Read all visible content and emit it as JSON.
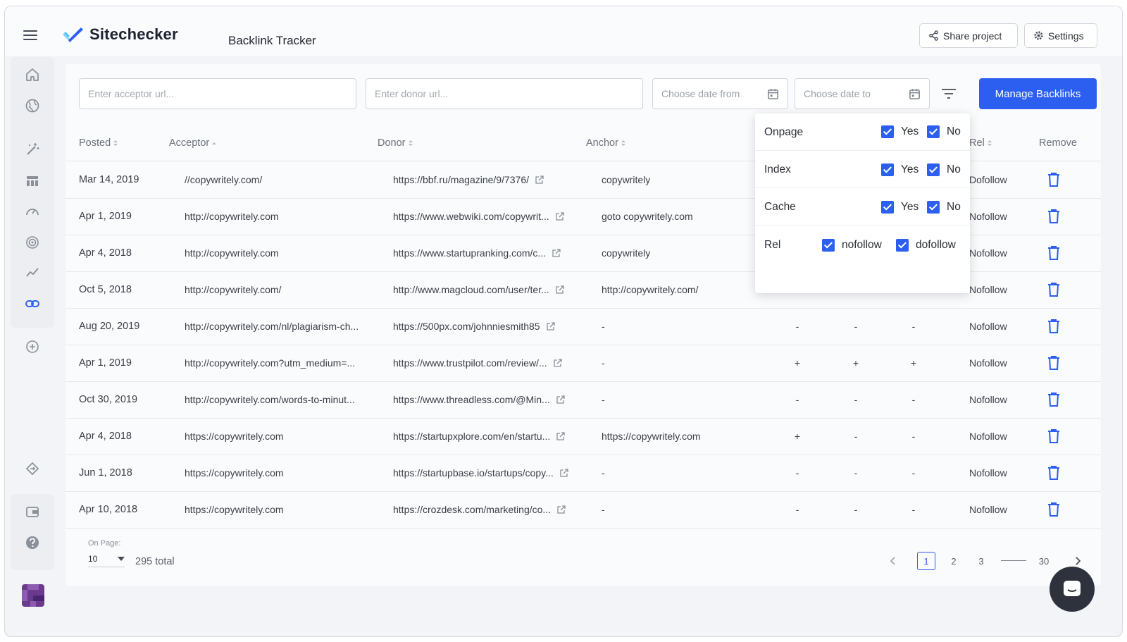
{
  "header": {
    "brand": "Sitechecker",
    "page_title": "Backlink Tracker",
    "share_label": "Share project",
    "settings_label": "Settings"
  },
  "filters": {
    "acceptor_placeholder": "Enter acceptor url...",
    "donor_placeholder": "Enter donor url...",
    "date_from_placeholder": "Choose date from",
    "date_to_placeholder": "Choose date to",
    "manage_label": "Manage Backlinks"
  },
  "columns": {
    "posted": "Posted",
    "acceptor": "Acceptor",
    "donor": "Donor",
    "anchor": "Anchor",
    "rel": "Rel",
    "remove": "Remove"
  },
  "rows": [
    {
      "posted": "Mar 14, 2019",
      "acceptor": "//copywritely.com/",
      "donor": "https://bbf.ru/magazine/9/7376/",
      "anchor": "copywritely",
      "m1": "",
      "m2": "",
      "m3": "",
      "rel": "Dofollow"
    },
    {
      "posted": "Apr 1, 2019",
      "acceptor": "http://copywritely.com",
      "donor": "https://www.webwiki.com/copywrit...",
      "anchor": "goto copywritely.com",
      "m1": "",
      "m2": "",
      "m3": "",
      "rel": "Nofollow"
    },
    {
      "posted": "Apr 4, 2018",
      "acceptor": "http://copywritely.com",
      "donor": "https://www.startupranking.com/c...",
      "anchor": "copywritely",
      "m1": "",
      "m2": "",
      "m3": "",
      "rel": "Nofollow"
    },
    {
      "posted": "Oct 5, 2018",
      "acceptor": "http://copywritely.com/",
      "donor": "http://www.magcloud.com/user/ter...",
      "anchor": "http://copywritely.com/",
      "m1": "",
      "m2": "",
      "m3": "",
      "rel": "Nofollow"
    },
    {
      "posted": "Aug 20, 2019",
      "acceptor": "http://copywritely.com/nl/plagiarism-ch...",
      "donor": "https://500px.com/johnniesmith85",
      "anchor": "-",
      "m1": "-",
      "m2": "-",
      "m3": "-",
      "rel": "Nofollow"
    },
    {
      "posted": "Apr 1, 2019",
      "acceptor": "http://copywritely.com?utm_medium=...",
      "donor": "https://www.trustpilot.com/review/...",
      "anchor": "-",
      "m1": "+",
      "m2": "+",
      "m3": "+",
      "rel": "Nofollow"
    },
    {
      "posted": "Oct 30, 2019",
      "acceptor": "http://copywritely.com/words-to-minut...",
      "donor": "https://www.threadless.com/@Min...",
      "anchor": "-",
      "m1": "-",
      "m2": "-",
      "m3": "-",
      "rel": "Nofollow"
    },
    {
      "posted": "Apr 4, 2018",
      "acceptor": "https://copywritely.com",
      "donor": "https://startupxplore.com/en/startu...",
      "anchor": "https://copywritely.com",
      "m1": "+",
      "m2": "-",
      "m3": "-",
      "rel": "Nofollow"
    },
    {
      "posted": "Jun 1, 2018",
      "acceptor": "https://copywritely.com",
      "donor": "https://startupbase.io/startups/copy...",
      "anchor": "-",
      "m1": "-",
      "m2": "-",
      "m3": "-",
      "rel": "Nofollow"
    },
    {
      "posted": "Apr 10, 2018",
      "acceptor": "https://copywritely.com",
      "donor": "https://crozdesk.com/marketing/co...",
      "anchor": "-",
      "m1": "-",
      "m2": "-",
      "m3": "-",
      "rel": "Nofollow"
    }
  ],
  "footer": {
    "on_page_label": "On Page:",
    "on_page_value": "10",
    "total": "295 total",
    "pages": [
      "1",
      "2",
      "3",
      "30"
    ]
  },
  "filter_popover": {
    "onpage_label": "Onpage",
    "index_label": "Index",
    "cache_label": "Cache",
    "rel_label": "Rel",
    "yes": "Yes",
    "no": "No",
    "nofollow": "nofollow",
    "dofollow": "dofollow"
  },
  "colors": {
    "accent": "#2c5ef0",
    "brand_cyan": "#4fc3f7",
    "text": "#2c2f36"
  },
  "icons": [
    "menu-icon",
    "home-icon",
    "globe-icon",
    "magic-wand-icon",
    "table-icon",
    "speedometer-icon",
    "target-icon",
    "trend-icon",
    "link-icon",
    "plus-circle-icon",
    "tag-icon",
    "wallet-icon",
    "help-icon",
    "share-icon",
    "gear-icon",
    "calendar-icon",
    "filter-icon",
    "external-link-icon",
    "trash-icon",
    "chevron-left-icon",
    "chevron-right-icon",
    "chat-icon"
  ]
}
